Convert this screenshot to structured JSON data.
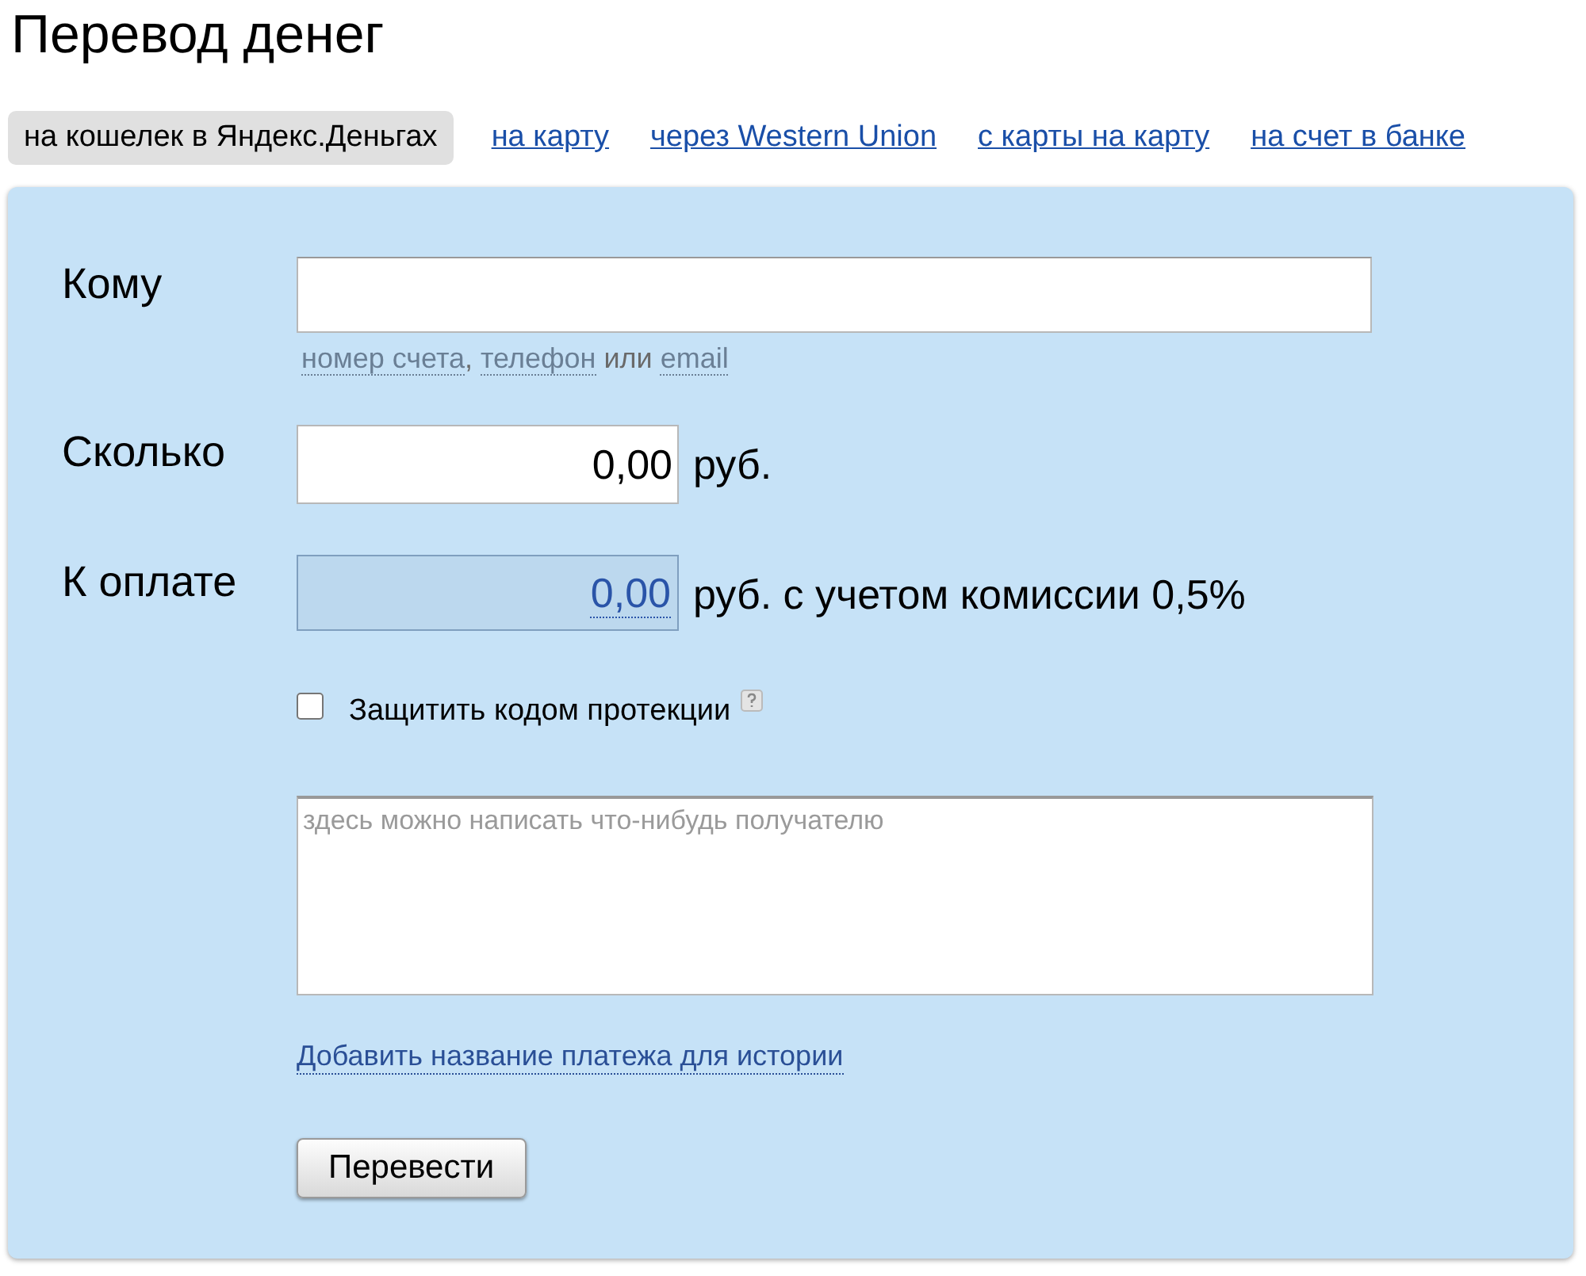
{
  "title": "Перевод денег",
  "tabs": [
    {
      "label": "на кошелек в Яндекс.Деньгах",
      "selected": true
    },
    {
      "label": "на карту",
      "selected": false
    },
    {
      "label": "через Western Union",
      "selected": false
    },
    {
      "label": "с карты на карту",
      "selected": false
    },
    {
      "label": "на счет в банке",
      "selected": false
    }
  ],
  "recipient": {
    "label": "Кому",
    "hint": [
      {
        "text": "номер счета",
        "kind": "link"
      },
      {
        "text": ",",
        "kind": "text"
      },
      {
        "text": "телефон",
        "kind": "link"
      },
      {
        "text": "или",
        "kind": "text"
      },
      {
        "text": "email",
        "kind": "link"
      }
    ]
  },
  "amount": {
    "label": "Сколько",
    "value": "0,00",
    "unit": "руб."
  },
  "payable": {
    "label": "К оплате",
    "value": "0,00",
    "note": "руб. с учетом комиссии 0,5%"
  },
  "protect": {
    "label": "Защитить кодом протекции",
    "checked": false
  },
  "message": {
    "placeholder": "здесь можно написать что-нибудь получателю"
  },
  "history_link": "Добавить название платежа для истории",
  "submit": "Перевести"
}
